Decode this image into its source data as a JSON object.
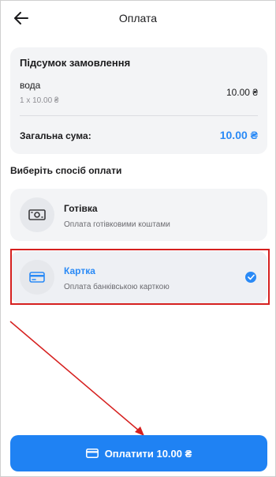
{
  "header": {
    "title": "Оплата",
    "back_icon": "arrow-left-icon"
  },
  "summary": {
    "title": "Підсумок замовлення",
    "items": [
      {
        "name": "вода",
        "quantity_line": "1 x 10.00 ₴",
        "price": "10.00 ₴"
      }
    ],
    "total_label": "Загальна сума:",
    "total_value": "10.00 ₴"
  },
  "payment": {
    "section_title": "Виберіть спосіб оплати",
    "options": [
      {
        "title": "Готівка",
        "subtitle": "Оплата готівковими коштами",
        "icon": "cash-icon",
        "selected": false
      },
      {
        "title": "Картка",
        "subtitle": "Оплата банківською карткою",
        "icon": "credit-card-icon",
        "selected": true
      }
    ]
  },
  "pay_button": {
    "label": "Оплатити 10.00 ₴",
    "icon": "credit-card-icon"
  },
  "colors": {
    "accent": "#2a8af6",
    "button": "#1f82f3",
    "annotation": "#d6201f",
    "card_bg": "#f3f4f6"
  }
}
